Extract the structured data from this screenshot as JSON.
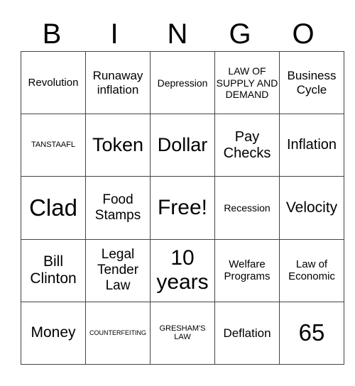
{
  "header": {
    "letters": [
      "B",
      "I",
      "N",
      "G",
      "O"
    ]
  },
  "board": {
    "rows": [
      [
        "Revolution",
        "Runaway inflation",
        "Depression",
        "LAW OF SUPPLY AND DEMAND",
        "Business Cycle"
      ],
      [
        "TANSTAAFL",
        "Token",
        "Dollar",
        "Pay Checks",
        "Inflation"
      ],
      [
        "Clad",
        "Food Stamps",
        "Free!",
        "Recession",
        "Velocity"
      ],
      [
        "Bill Clinton",
        "Legal Tender Law",
        "10 years",
        "Welfare Programs",
        "Law of Economic"
      ],
      [
        "Money",
        "COUNTERFEITING",
        "GRESHAM'S LAW",
        "Deflation",
        "65"
      ]
    ]
  }
}
